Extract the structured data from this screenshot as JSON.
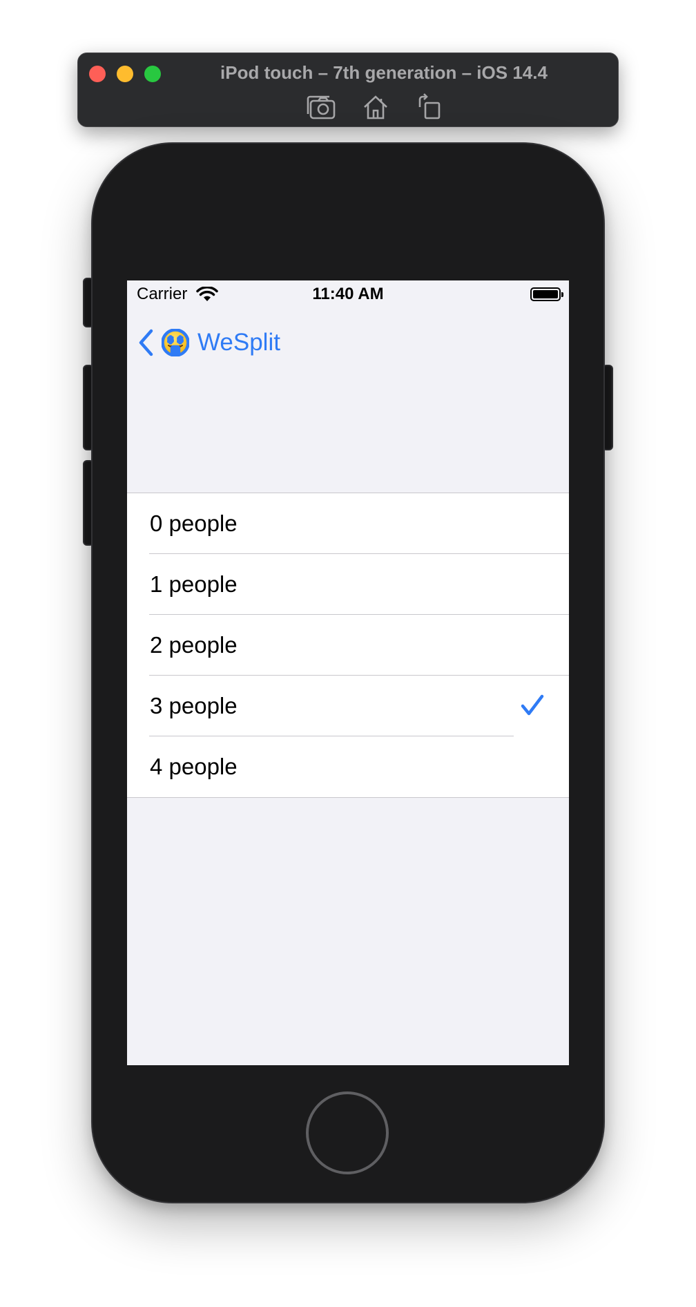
{
  "simulator": {
    "title": "iPod touch – 7th generation – iOS 14.4",
    "toolbar": [
      {
        "icon": "screenshot-icon"
      },
      {
        "icon": "home-icon"
      },
      {
        "icon": "rotate-icon"
      }
    ]
  },
  "status_bar": {
    "carrier": "Carrier",
    "time": "11:40 AM",
    "wifi_icon": "wifi-icon",
    "battery_icon": "battery-icon"
  },
  "nav": {
    "back_icon": "chevron-left-icon",
    "back_emoji": "money-mouth-face",
    "back_title": "WeSplit"
  },
  "options": [
    {
      "label": "0 people",
      "selected": false
    },
    {
      "label": "1 people",
      "selected": false
    },
    {
      "label": "2 people",
      "selected": false
    },
    {
      "label": "3 people",
      "selected": true
    },
    {
      "label": "4 people",
      "selected": false
    }
  ],
  "colors": {
    "accent": "#2f7bf5",
    "background": "#f2f2f7",
    "separator": "#c8c7cc",
    "device": "#1b1b1c"
  }
}
